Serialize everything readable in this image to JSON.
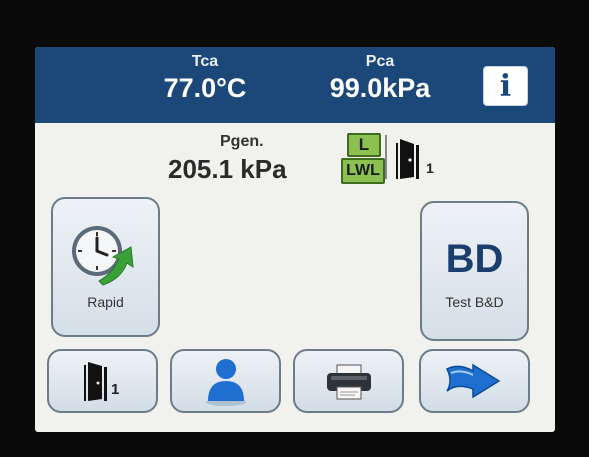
{
  "header": {
    "tca": {
      "label": "Tca",
      "value": "77.0°C"
    },
    "pca": {
      "label": "Pca",
      "value": "99.0kPa"
    },
    "info_icon": "info-icon",
    "info_glyph": "i"
  },
  "generator": {
    "label": "Pgen.",
    "value": "205.1 kPa",
    "badge_l": "L",
    "badge_lwl": "LWL",
    "door_number": "1"
  },
  "buttons": {
    "rapid": {
      "label": "Rapid",
      "icon": "clock-arrow-icon"
    },
    "bd": {
      "big_text": "BD",
      "label": "Test B&D"
    },
    "door": {
      "number": "1",
      "icon": "door-icon"
    },
    "user": {
      "icon": "user-icon"
    },
    "print": {
      "icon": "printer-icon"
    },
    "next": {
      "icon": "arrow-right-icon"
    }
  },
  "colors": {
    "header_bg": "#1c4879",
    "screen_bg": "#f1f1ee",
    "badge_green": "#8cc152",
    "accent_green": "#3aa13a",
    "accent_blue": "#1f6fd0"
  }
}
